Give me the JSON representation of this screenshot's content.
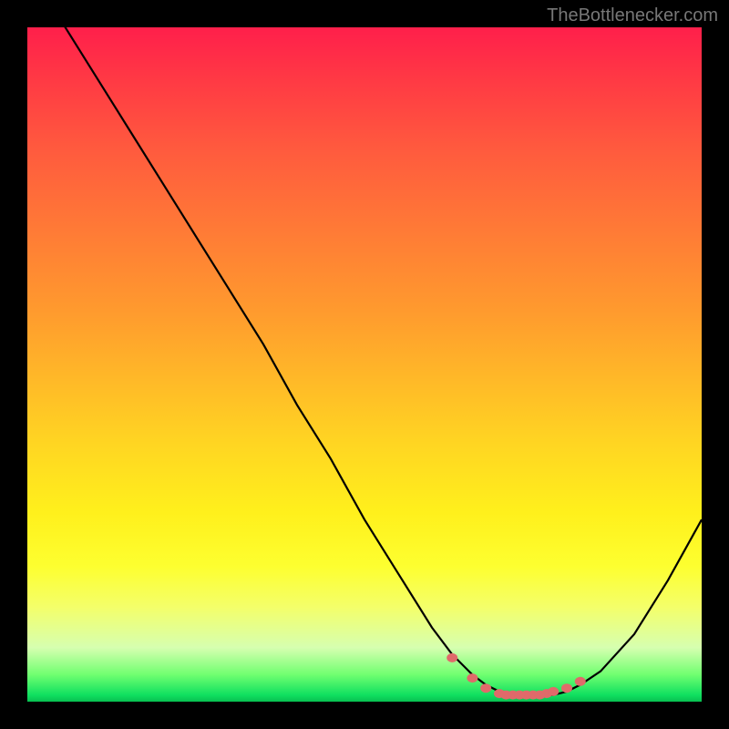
{
  "attribution": "TheBottlenecker.com",
  "chart_data": {
    "type": "line",
    "title": "",
    "xlabel": "",
    "ylabel": "",
    "xlim": [
      0,
      100
    ],
    "ylim": [
      0,
      100
    ],
    "annotations": [],
    "series": [
      {
        "name": "curve",
        "x": [
          0,
          5,
          10,
          15,
          20,
          25,
          30,
          35,
          40,
          45,
          50,
          55,
          60,
          63,
          66,
          68,
          70,
          72,
          74,
          76,
          78,
          80,
          82,
          85,
          90,
          95,
          100
        ],
        "y": [
          108,
          101,
          93,
          85,
          77,
          69,
          61,
          53,
          44,
          36,
          27,
          19,
          11,
          7,
          4,
          2.5,
          1.5,
          1,
          1,
          1,
          1,
          1.5,
          2.5,
          4.5,
          10,
          18,
          27
        ]
      }
    ],
    "markers": {
      "x": [
        63,
        66,
        68,
        70,
        71,
        72,
        73,
        74,
        75,
        76,
        77,
        78,
        80,
        82
      ],
      "y": [
        6.5,
        3.5,
        2,
        1.2,
        1,
        1,
        1,
        1,
        1,
        1,
        1.2,
        1.5,
        2,
        3
      ],
      "color": "#e06a6a"
    }
  },
  "gradient": {
    "top_color": "#ff1f4b",
    "bottom_color": "#08c050"
  }
}
